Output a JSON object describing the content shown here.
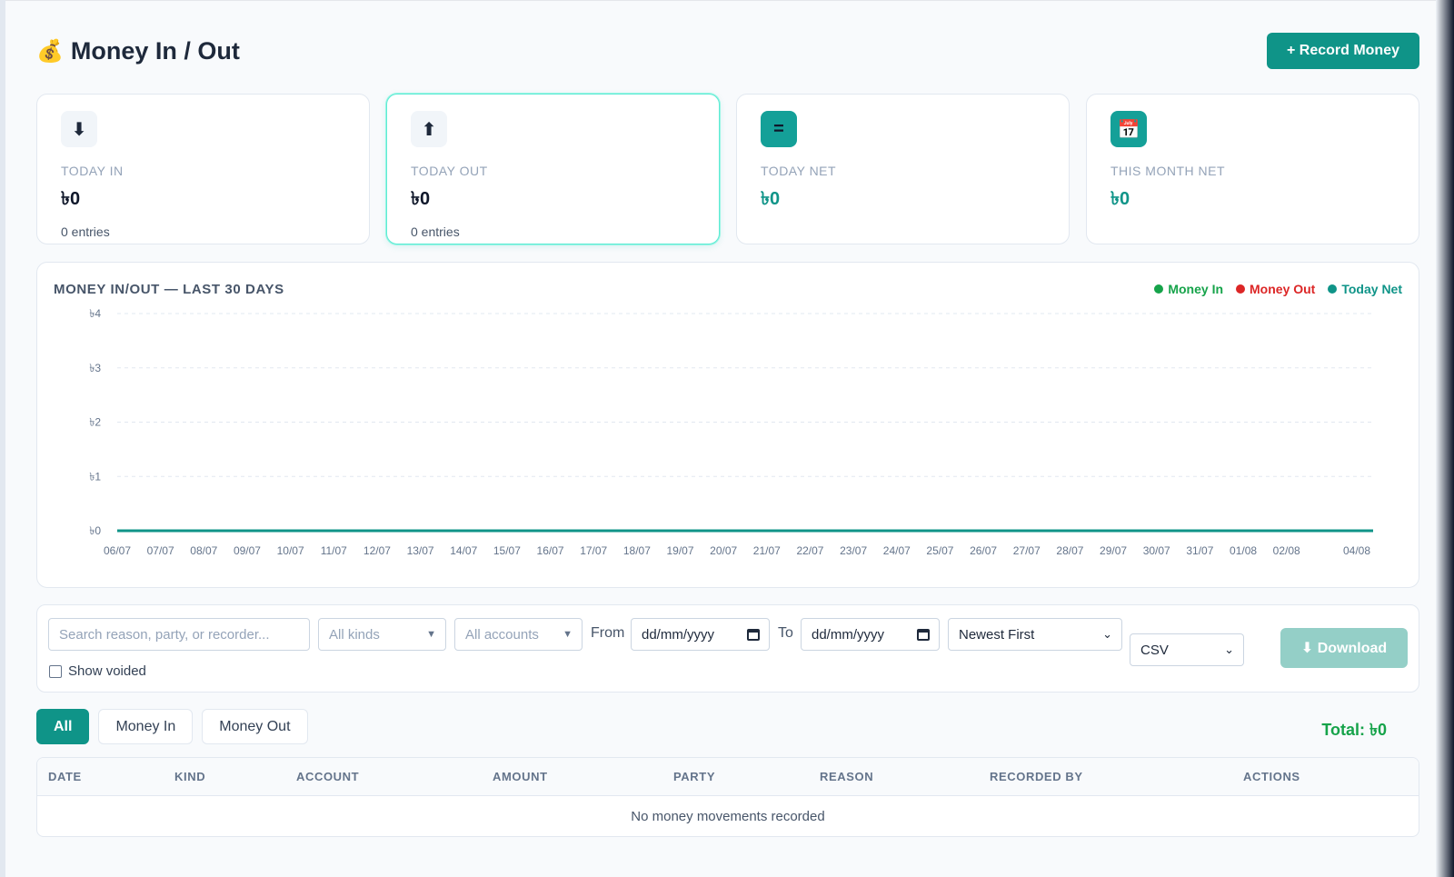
{
  "header": {
    "emoji": "💰",
    "title": "Money In / Out",
    "record_button": "+ Record Money"
  },
  "cards": [
    {
      "icon": "arrow-down-icon",
      "glyph": "⬇",
      "label": "TODAY IN",
      "value": "৳0",
      "sub": "0 entries"
    },
    {
      "icon": "arrow-up-icon",
      "glyph": "⬆",
      "label": "TODAY OUT",
      "value": "৳0",
      "sub": "0 entries"
    },
    {
      "icon": "equals-icon",
      "glyph": "=",
      "label": "TODAY NET",
      "value": "৳0"
    },
    {
      "icon": "calendar-icon",
      "glyph": "📅",
      "label": "THIS MONTH NET",
      "value": "৳0"
    }
  ],
  "chart": {
    "title": "MONEY IN/OUT — LAST 30 DAYS",
    "legend": [
      {
        "name": "Money In",
        "color": "#16a34a"
      },
      {
        "name": "Money Out",
        "color": "#dc2626"
      },
      {
        "name": "Today Net",
        "color": "#0f9488"
      }
    ]
  },
  "chart_data": {
    "type": "line",
    "title": "MONEY IN/OUT — LAST 30 DAYS",
    "categories": [
      "06/07",
      "07/07",
      "08/07",
      "09/07",
      "10/07",
      "11/07",
      "12/07",
      "13/07",
      "14/07",
      "15/07",
      "16/07",
      "17/07",
      "18/07",
      "19/07",
      "20/07",
      "21/07",
      "22/07",
      "23/07",
      "24/07",
      "25/07",
      "26/07",
      "27/07",
      "28/07",
      "29/07",
      "30/07",
      "31/07",
      "01/08",
      "02/08",
      "04/08"
    ],
    "yticks": [
      "৳0",
      "৳1",
      "৳2",
      "৳3",
      "৳4"
    ],
    "ylim": [
      0,
      4
    ],
    "grid": true,
    "legend_position": "top-right",
    "series": [
      {
        "name": "Money In",
        "color": "#16a34a",
        "values": [
          0,
          0,
          0,
          0,
          0,
          0,
          0,
          0,
          0,
          0,
          0,
          0,
          0,
          0,
          0,
          0,
          0,
          0,
          0,
          0,
          0,
          0,
          0,
          0,
          0,
          0,
          0,
          0,
          0
        ]
      },
      {
        "name": "Money Out",
        "color": "#dc2626",
        "values": [
          0,
          0,
          0,
          0,
          0,
          0,
          0,
          0,
          0,
          0,
          0,
          0,
          0,
          0,
          0,
          0,
          0,
          0,
          0,
          0,
          0,
          0,
          0,
          0,
          0,
          0,
          0,
          0,
          0
        ]
      },
      {
        "name": "Today Net",
        "color": "#0f9488",
        "values": [
          0,
          0,
          0,
          0,
          0,
          0,
          0,
          0,
          0,
          0,
          0,
          0,
          0,
          0,
          0,
          0,
          0,
          0,
          0,
          0,
          0,
          0,
          0,
          0,
          0,
          0,
          0,
          0,
          0
        ]
      }
    ]
  },
  "filters": {
    "search_placeholder": "Search reason, party, or recorder...",
    "kind": "All kinds",
    "account": "All accounts",
    "from_label": "From",
    "from_value": "dd/mm/yyyy",
    "to_label": "To",
    "to_value": "dd/mm/yyyy",
    "sort": "Newest First",
    "format": "CSV",
    "download": "⬇ Download",
    "show_voided": "Show voided"
  },
  "tabs": [
    "All",
    "Money In",
    "Money Out"
  ],
  "total": "Total: ৳0",
  "table": {
    "columns": [
      "DATE",
      "KIND",
      "ACCOUNT",
      "AMOUNT",
      "PARTY",
      "REASON",
      "RECORDED BY",
      "ACTIONS"
    ],
    "empty": "No money movements recorded"
  }
}
